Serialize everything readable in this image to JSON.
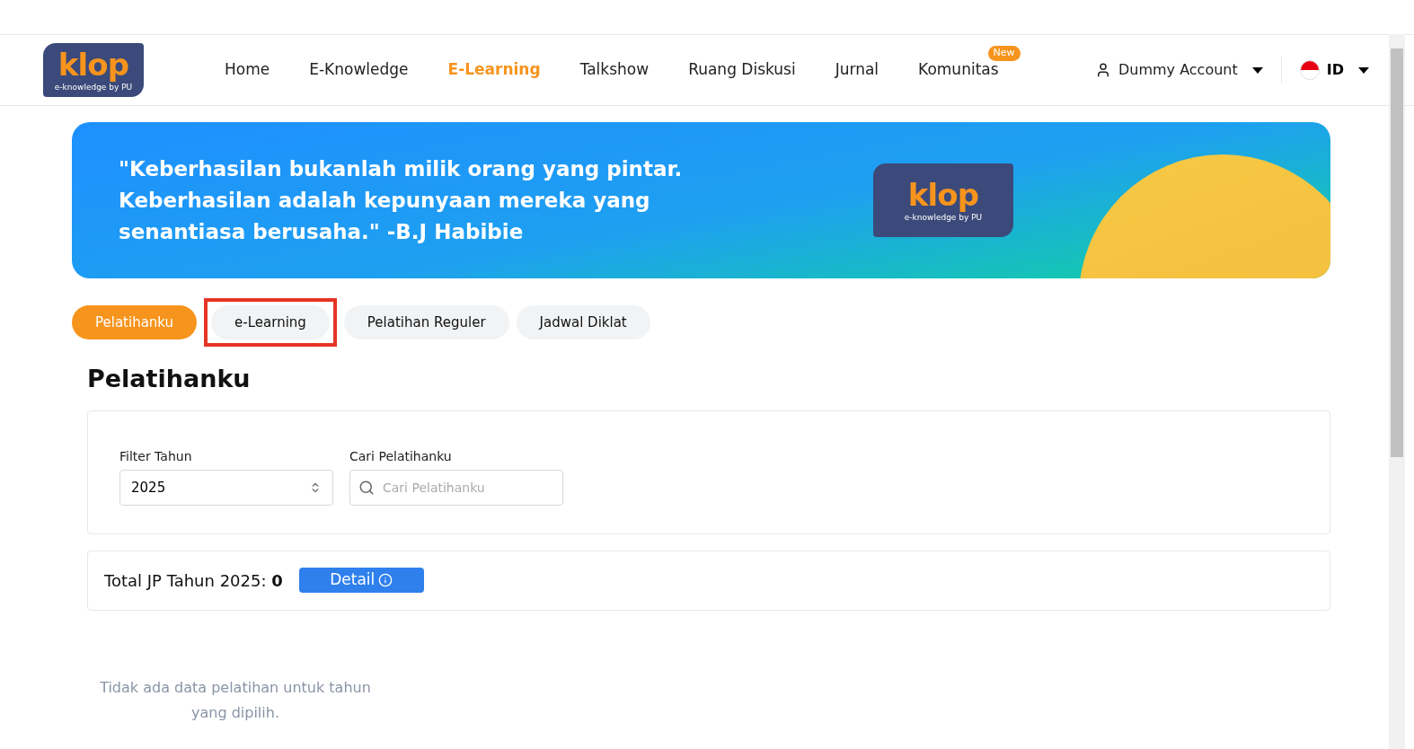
{
  "logo": {
    "wordmark": "klop",
    "tagline": "e-knowledge by PU"
  },
  "nav": [
    {
      "label": "Home",
      "selected": false
    },
    {
      "label": "E-Knowledge",
      "selected": false
    },
    {
      "label": "E-Learning",
      "selected": true
    },
    {
      "label": "Talkshow",
      "selected": false
    },
    {
      "label": "Ruang Diskusi",
      "selected": false
    },
    {
      "label": "Jurnal",
      "selected": false
    },
    {
      "label": "Komunitas",
      "selected": false,
      "badge": "New"
    }
  ],
  "account": {
    "name": "Dummy Account"
  },
  "language": {
    "code": "ID"
  },
  "banner": {
    "quote": "\"Keberhasilan bukanlah milik orang yang pintar. Keberhasilan adalah kepunyaan mereka yang senantiasa berusaha.\" -B.J Habibie",
    "logo": {
      "wordmark": "klop",
      "tagline": "e-knowledge by PU"
    }
  },
  "tabs": [
    {
      "label": "Pelatihanku",
      "selected": true,
      "highlighted": false
    },
    {
      "label": "e-Learning",
      "selected": false,
      "highlighted": true
    },
    {
      "label": "Pelatihan Reguler",
      "selected": false,
      "highlighted": false
    },
    {
      "label": "Jadwal Diklat",
      "selected": false,
      "highlighted": false
    }
  ],
  "section_title": "Pelatihanku",
  "filters": {
    "year": {
      "label": "Filter Tahun",
      "value": "2025"
    },
    "search": {
      "label": "Cari Pelatihanku",
      "placeholder": "Cari Pelatihanku"
    }
  },
  "total": {
    "text": "Total JP Tahun 2025: **0**",
    "button": "Detail"
  },
  "empty_message": "Tidak ada data pelatihan untuk tahun yang dipilih."
}
